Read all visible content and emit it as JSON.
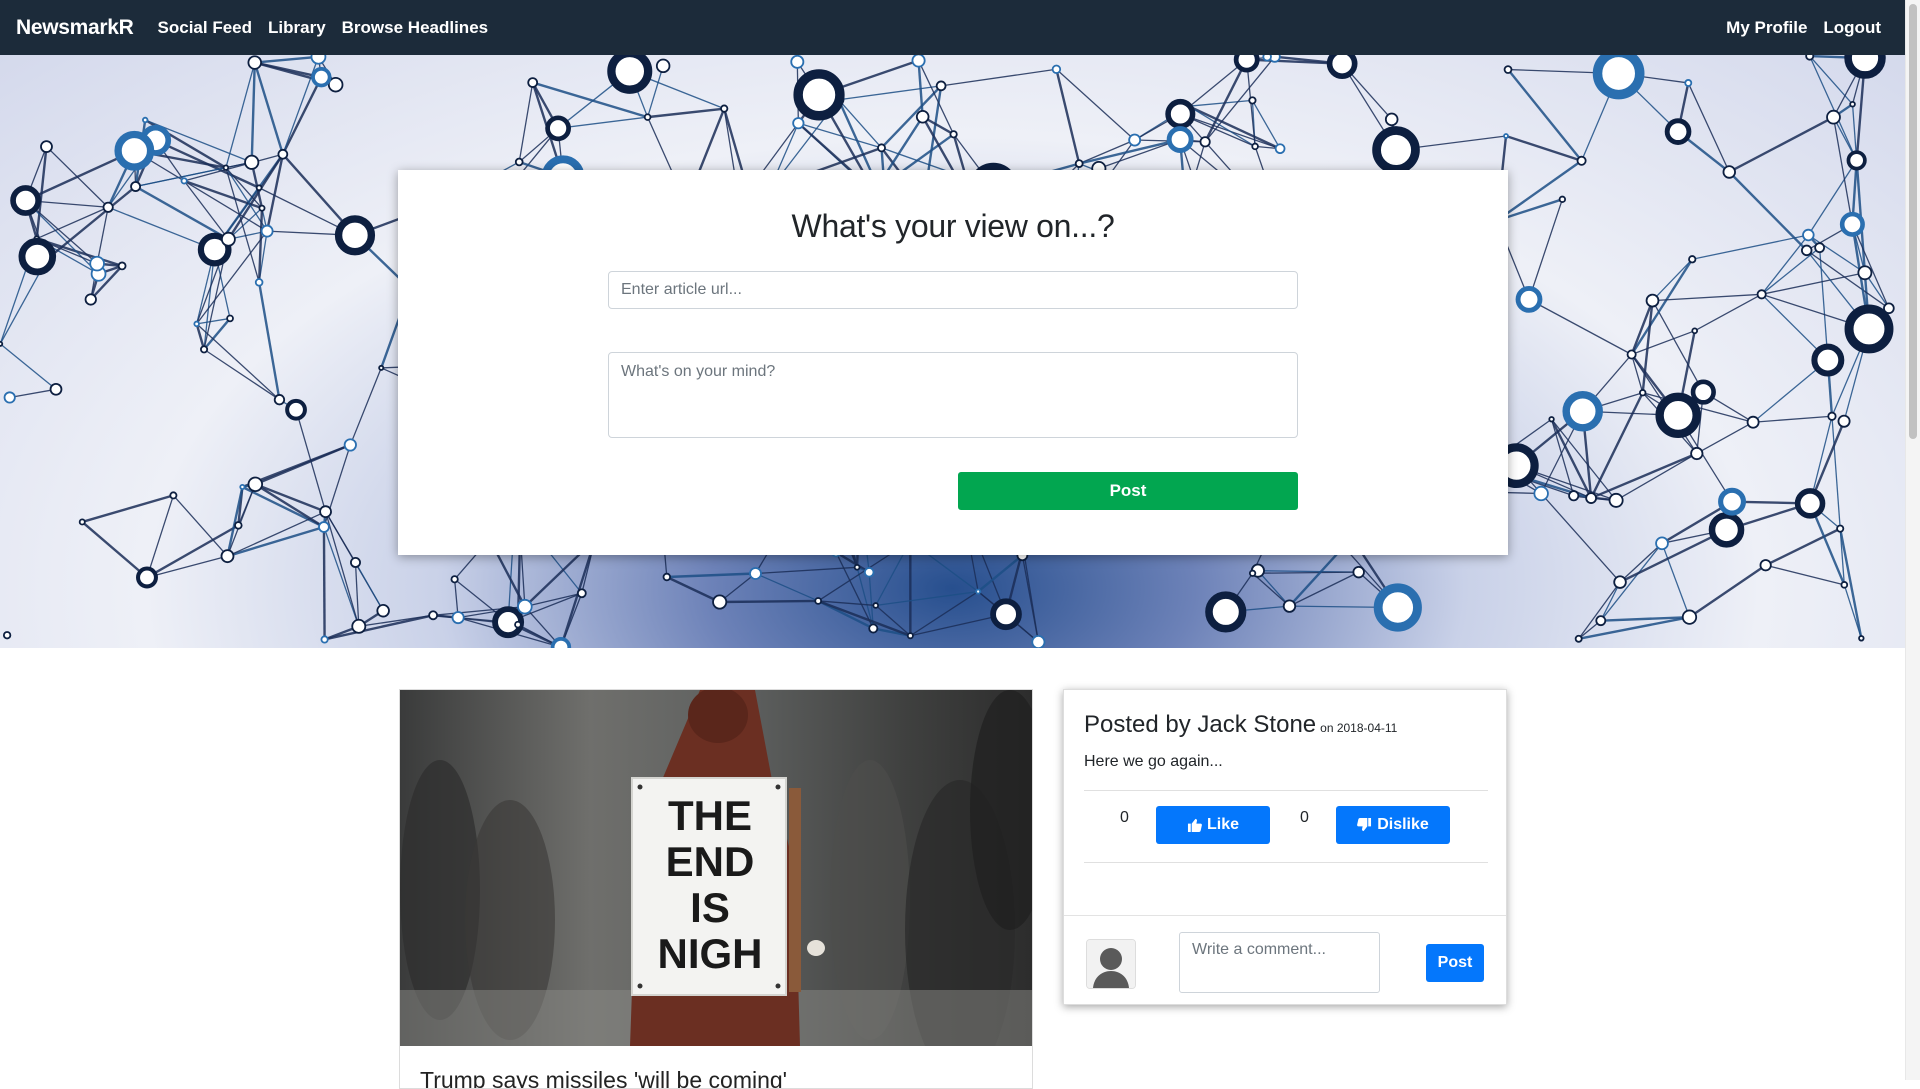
{
  "navbar": {
    "brand": "NewsmarkR",
    "links": [
      "Social Feed",
      "Library",
      "Browse Headlines"
    ],
    "right_links": [
      "My Profile",
      "Logout"
    ]
  },
  "composer": {
    "heading": "What's your view on...?",
    "url_placeholder": "Enter article url...",
    "mind_placeholder": "What's on your mind?",
    "post_label": "Post"
  },
  "article": {
    "image_sign": [
      "THE",
      "END",
      "IS",
      "NIGH"
    ],
    "title": "Trump says missiles 'will be coming'"
  },
  "social_post": {
    "posted_by": "Posted by Jack Stone",
    "date": "on 2018-04-11",
    "text": "Here we go again...",
    "likes": "0",
    "like_label": "Like",
    "dislikes": "0",
    "dislike_label": "Dislike",
    "comment_placeholder": "Write a comment...",
    "comment_post_label": "Post"
  },
  "colors": {
    "navbar": "#1c2b3a",
    "post_green": "#02a650",
    "button_blue": "#0477fc"
  }
}
